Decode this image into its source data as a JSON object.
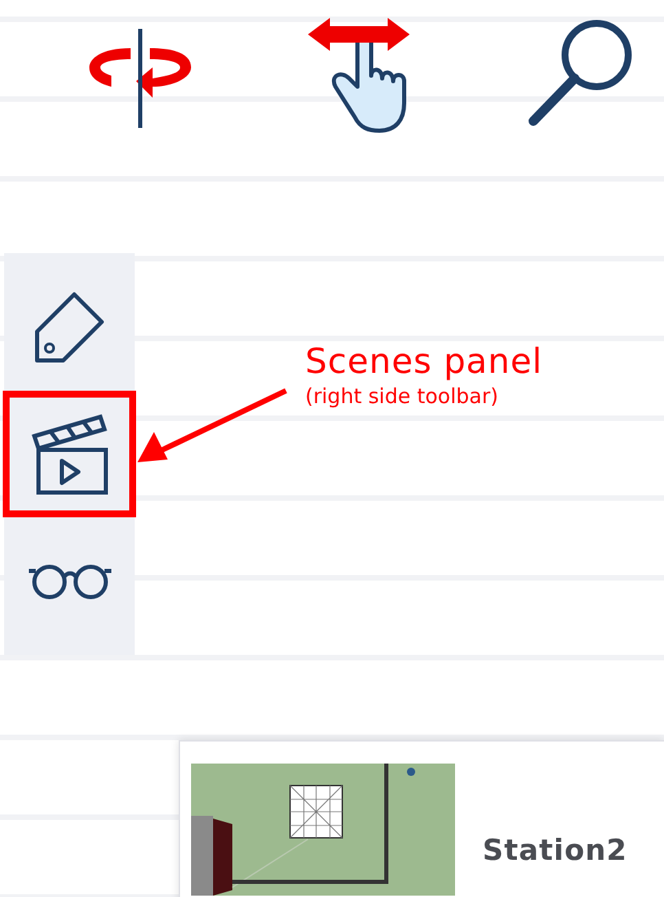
{
  "top_toolbar": [
    {
      "kind": "rotate"
    },
    {
      "kind": "pan"
    },
    {
      "kind": "zoom"
    }
  ],
  "side_toolbar": [
    {
      "kind": "tag",
      "highlighted": false
    },
    {
      "kind": "scenes",
      "highlighted": true
    },
    {
      "kind": "glasses",
      "highlighted": false
    }
  ],
  "annotation": {
    "title": "Scenes panel",
    "subtitle": "(right side toolbar)"
  },
  "scene_card": {
    "name": "Station2"
  }
}
